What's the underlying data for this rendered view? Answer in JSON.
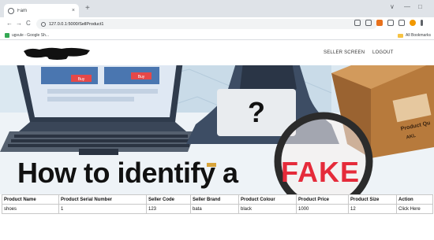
{
  "browser": {
    "tab_title": "Fam",
    "tab_close": "×",
    "new_tab": "+",
    "url": "127.0.0.1:5000/SellProduct1",
    "win_minimize": "—",
    "win_maximize": "□",
    "win_chevron": "∨",
    "nav_back": "←",
    "nav_forward": "→",
    "nav_reload": "C",
    "bookmark_left": "ugvule - Google Sh...",
    "bookmark_right": "All Bookmarks"
  },
  "navbar": {
    "seller_screen": "SELLER SCREEN",
    "logout": "LOGOUT"
  },
  "hero": {
    "headline": "How to identify a",
    "highlight": "FAKE",
    "question_mark": "?",
    "laptop_btn_1": "Buy",
    "laptop_btn_2": "Buy",
    "box_label": "Product Qu",
    "box_label_2": "AKL",
    "colors": {
      "fake_red": "#e52b3a",
      "headline": "#111111"
    }
  },
  "table": {
    "headers": [
      "Product Name",
      "Product Serial Number",
      "Seller Code",
      "Seller Brand",
      "Product Colour",
      "Product Price",
      "Product Size",
      "Action"
    ],
    "rows": [
      {
        "product_name": "shoes",
        "serial_number": "1",
        "seller_code": "123",
        "seller_brand": "bata",
        "colour": "black",
        "price": "1000",
        "size": "12",
        "action": "Click Here"
      }
    ]
  }
}
